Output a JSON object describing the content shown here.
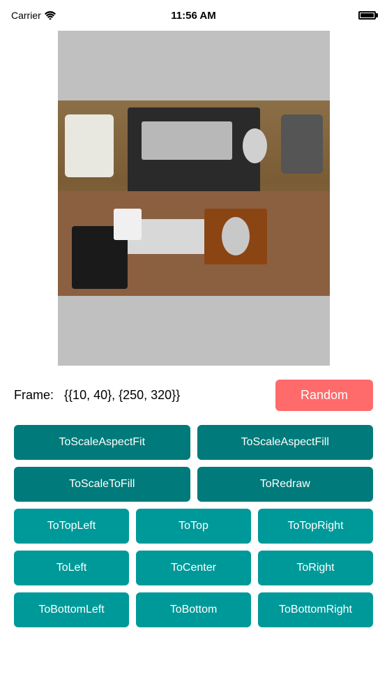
{
  "statusBar": {
    "carrier": "Carrier",
    "time": "11:56 AM"
  },
  "frame": {
    "label": "Frame:",
    "value": "{{10, 40}, {250, 320}}"
  },
  "buttons": {
    "random": "Random",
    "row1": [
      "ToScaleAspectFit",
      "ToScaleAspectFill"
    ],
    "row2": [
      "ToScaleToFill",
      "ToRedraw"
    ],
    "row3": [
      "ToTopLeft",
      "ToTop",
      "ToTopRight"
    ],
    "row4": [
      "ToLeft",
      "ToCenter",
      "ToRight"
    ],
    "row5": [
      "ToBottomLeft",
      "ToBottom",
      "ToBottomRight"
    ]
  }
}
